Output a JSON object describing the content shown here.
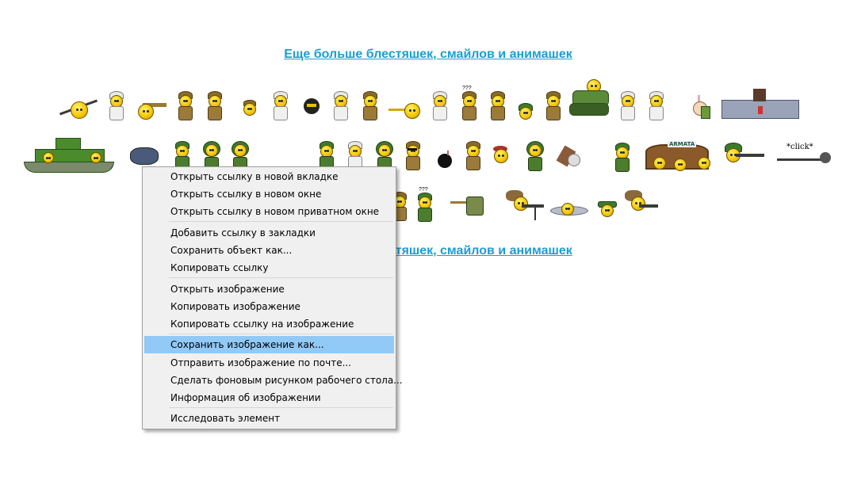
{
  "links": {
    "top": "Еще больше блестяшек, смайлов и анимашек",
    "bottom": "Еще больше блестяшек, смайлов и анимашек"
  },
  "smileys": {
    "click_label": "*click*",
    "sign_label": "ARMATA",
    "question_marks": "???"
  },
  "context_menu": {
    "groups": [
      [
        "Открыть ссылку в новой вкладке",
        "Открыть ссылку в новом окне",
        "Открыть ссылку в новом приватном окне"
      ],
      [
        "Добавить ссылку в закладки",
        "Сохранить объект как...",
        "Копировать ссылку"
      ],
      [
        "Открыть изображение",
        "Копировать изображение",
        "Копировать ссылку на изображение"
      ],
      [
        "Сохранить изображение как...",
        "Отправить изображение по почте...",
        "Сделать фоновым рисунком рабочего стола...",
        "Информация об изображении"
      ],
      [
        "Исследовать элемент"
      ]
    ],
    "selected": "Сохранить изображение как..."
  },
  "colors": {
    "link": "#1a9fd0",
    "menu_bg": "#f0f0f0",
    "menu_highlight": "#91c9f7"
  }
}
